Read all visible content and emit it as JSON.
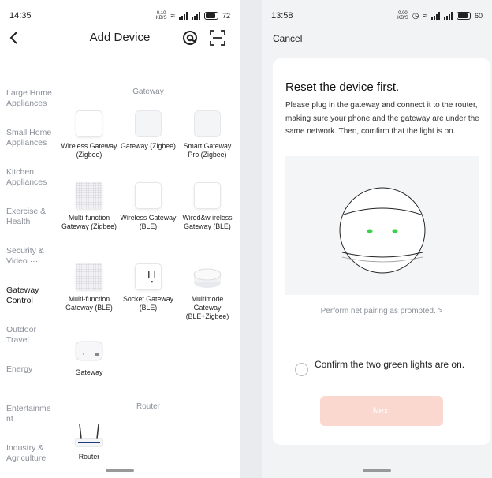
{
  "left": {
    "status": {
      "time": "14:35",
      "netspeed": "0.10 KB/S",
      "battery": "72"
    },
    "header": {
      "title": "Add Device",
      "back_icon": "chevron-left",
      "at_icon": "at-sign",
      "scan_icon": "scan-frame"
    },
    "categories": [
      "Large Home Appliances",
      "Small Home Appliances",
      "Kitchen Appliances",
      "Exercise & Health",
      "Security & Video ···",
      "Gateway Control",
      "Outdoor Travel",
      "Energy",
      "Entertainme nt",
      "Industry & Agriculture"
    ],
    "sections": {
      "gateway": "Gateway",
      "router": "Router"
    },
    "devices": [
      "Wireless Gateway (Zigbee)",
      "Gateway (Zigbee)",
      "Smart Gateway Pro (Zigbee)",
      "Multi-function Gateway (Zigbee)",
      "Wireless Gateway (BLE)",
      "Wired&w ireless Gateway (BLE)",
      "Multi-function Gateway (BLE)",
      "Socket Gateway (BLE)",
      "Multimode Gateway (BLE+Zigbee)",
      "Gateway",
      "Router"
    ]
  },
  "right": {
    "status": {
      "time": "13:58",
      "battery": "60"
    },
    "cancel": "Cancel",
    "title": "Reset the device first.",
    "description": "Please plug in the gateway and connect it to the router, making sure your phone and the gateway are under the same network. Then, comfirm that the light is on.",
    "link": "Perform net pairing as prompted. >",
    "confirm": "Confirm the two green lights are on.",
    "next": "Next",
    "colors": {
      "light": "#3ad14a",
      "button": "#fbd8cf"
    }
  }
}
